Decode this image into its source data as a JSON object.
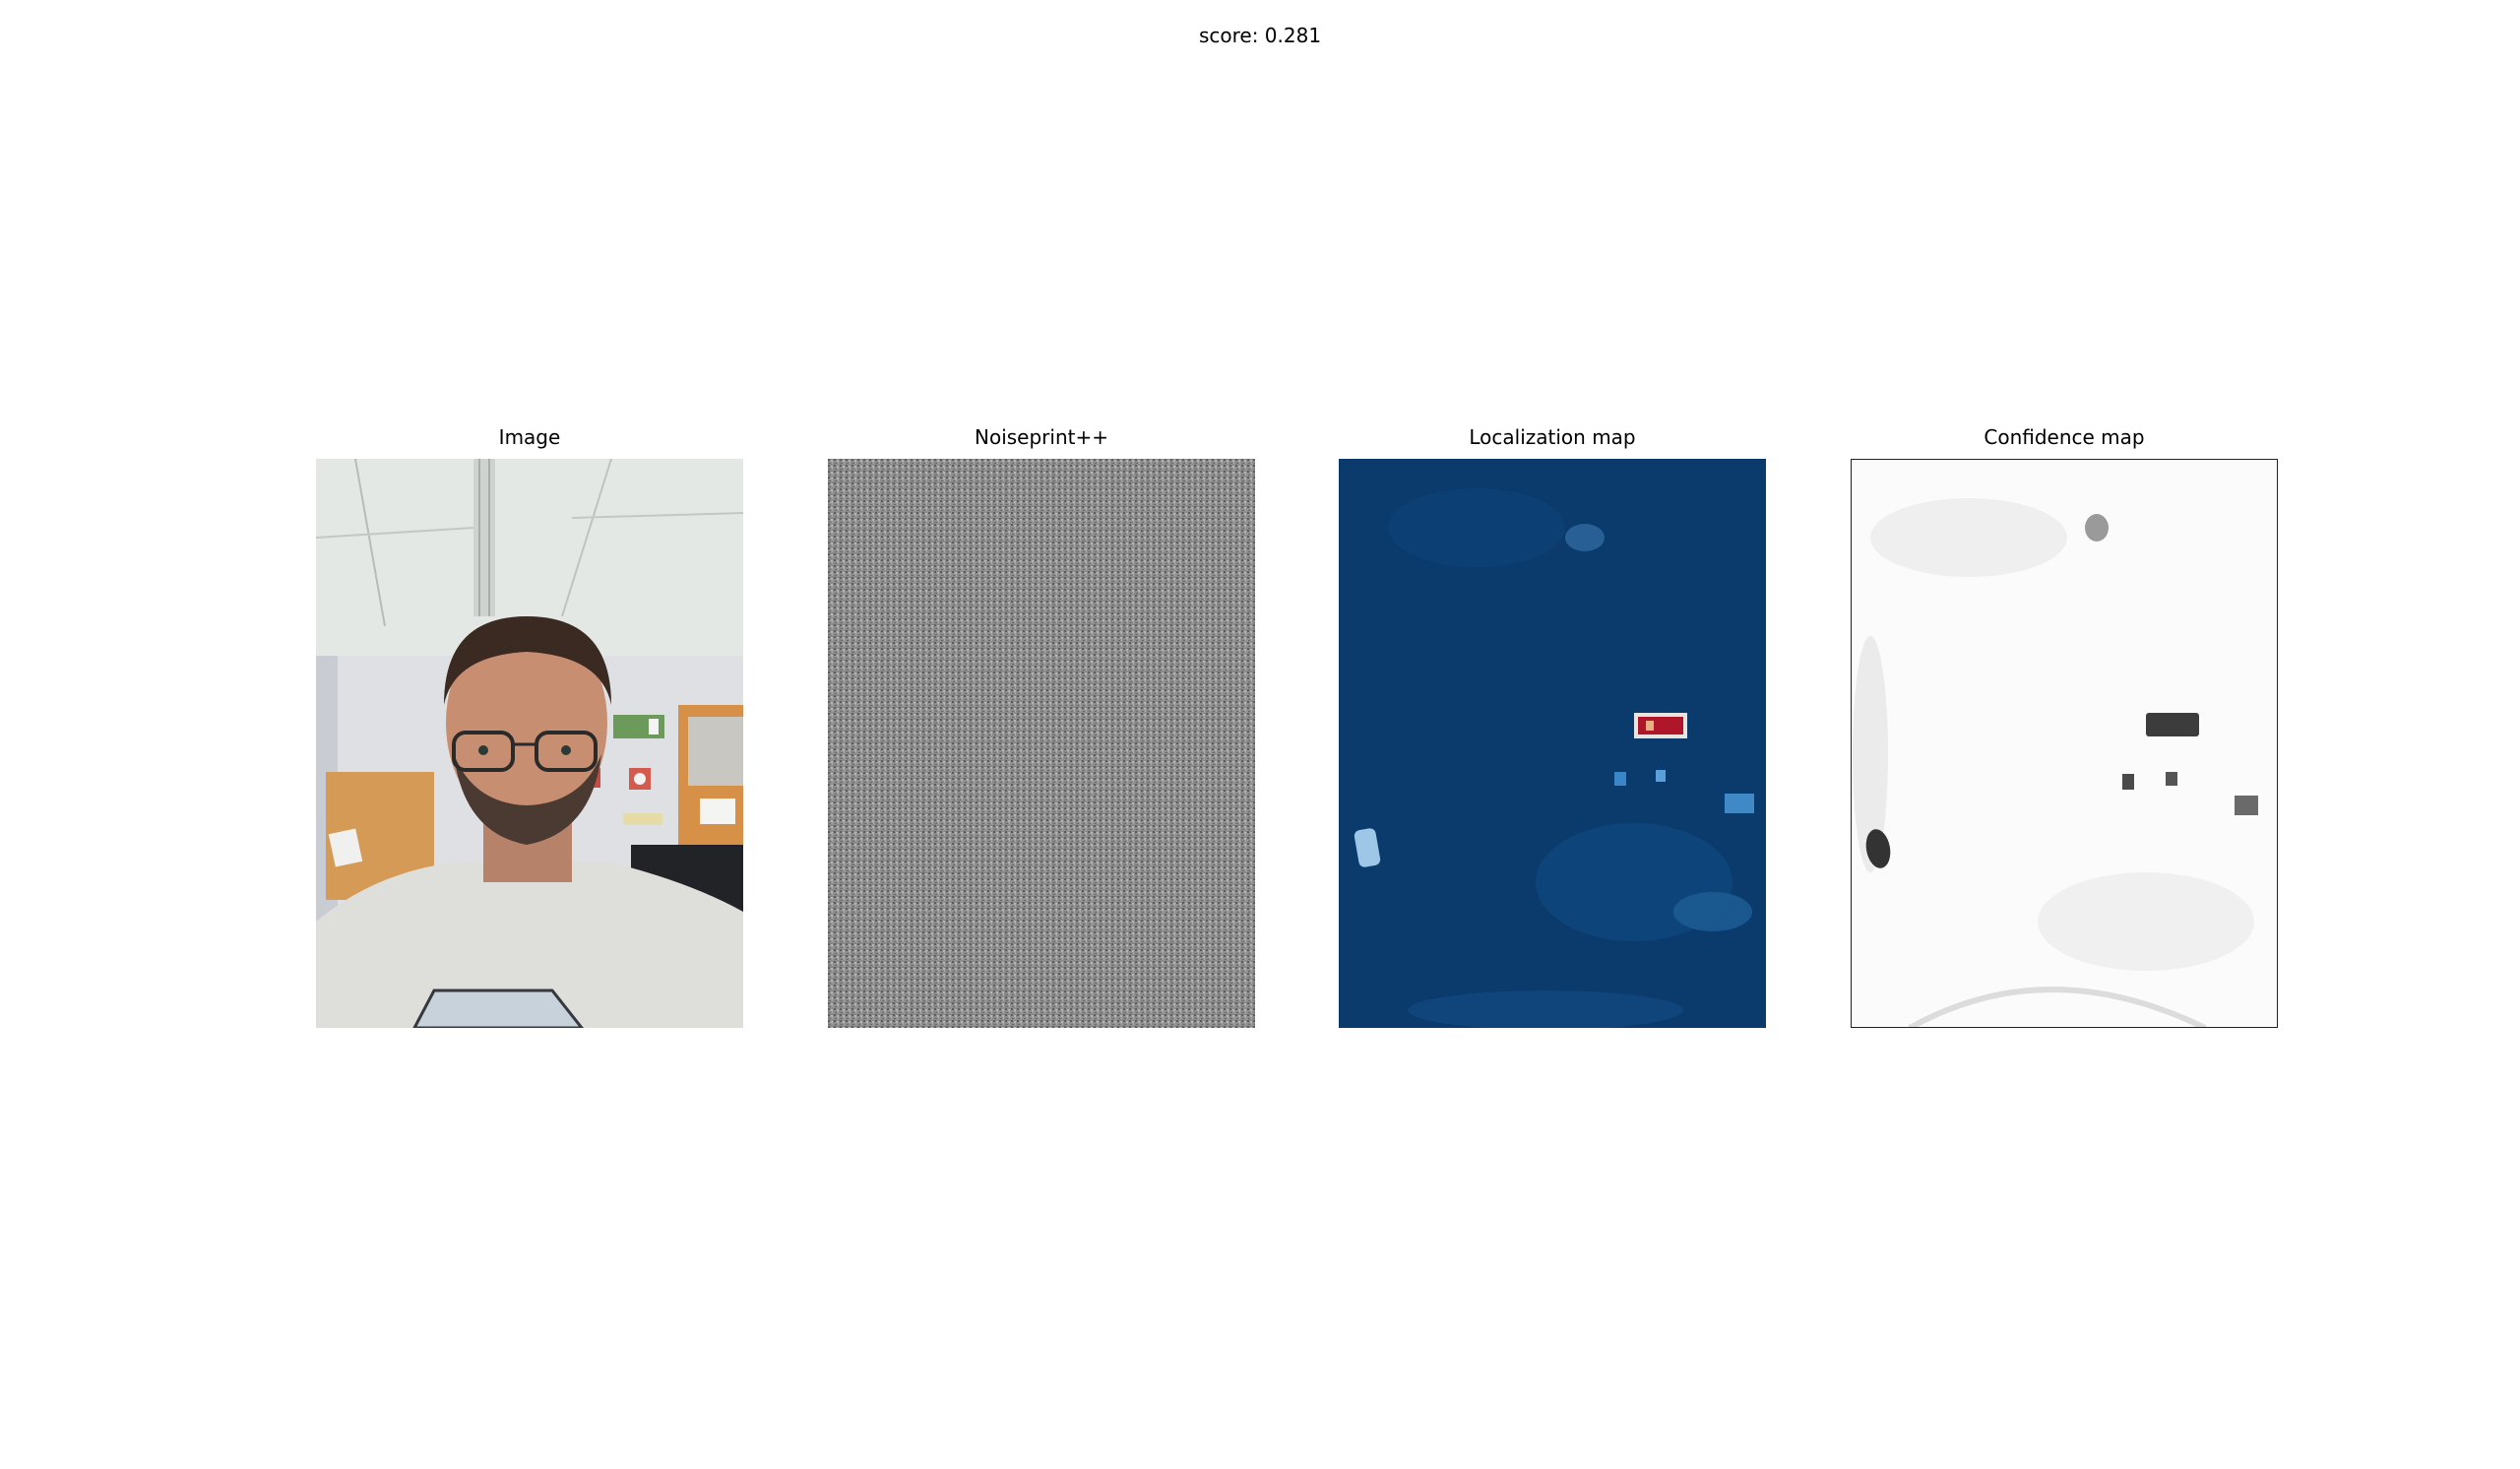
{
  "figure": {
    "score_label": "score: 0.281"
  },
  "panels": [
    {
      "title": "Image",
      "icon": "photo"
    },
    {
      "title": "Noiseprint++",
      "icon": "noise-texture"
    },
    {
      "title": "Localization map",
      "icon": "heatmap"
    },
    {
      "title": "Confidence map",
      "icon": "grayscale-map"
    }
  ],
  "colors": {
    "localization_bg": "#0a3a6e",
    "localization_hot": "#b0162a",
    "noise_gray": "#8a8a8a"
  }
}
